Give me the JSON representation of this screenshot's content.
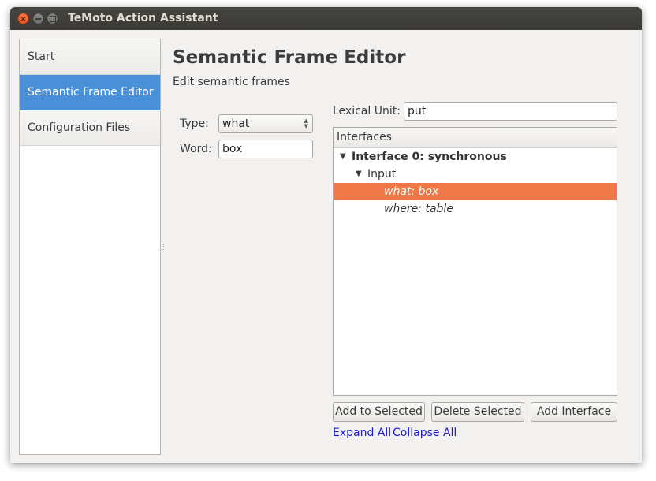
{
  "window": {
    "title": "TeMoto Action Assistant"
  },
  "sidebar": {
    "items": [
      {
        "label": "Start",
        "active": false
      },
      {
        "label": "Semantic Frame Editor",
        "active": true
      },
      {
        "label": "Configuration Files",
        "active": false
      }
    ]
  },
  "main": {
    "title": "Semantic Frame Editor",
    "subtitle": "Edit semantic frames",
    "type_label": "Type:",
    "type_value": "what",
    "word_label": "Word:",
    "word_value": "box",
    "lexical_label": "Lexical Unit:",
    "lexical_value": "put"
  },
  "tree": {
    "header": "Interfaces",
    "interface": "Interface 0: synchronous",
    "input": "Input",
    "items": [
      {
        "label": "what: box",
        "selected": true
      },
      {
        "label": "where: table",
        "selected": false
      }
    ]
  },
  "buttons": {
    "add_selected": "Add to Selected",
    "delete_selected": "Delete Selected",
    "add_interface": "Add Interface"
  },
  "links": {
    "expand_all": "Expand All",
    "collapse_all": "Collapse All"
  },
  "colors": {
    "accent_blue": "#4a90d9",
    "selection_orange": "#f07746",
    "link_blue": "#1a1ad4",
    "titlebar": "#3c3b37"
  }
}
